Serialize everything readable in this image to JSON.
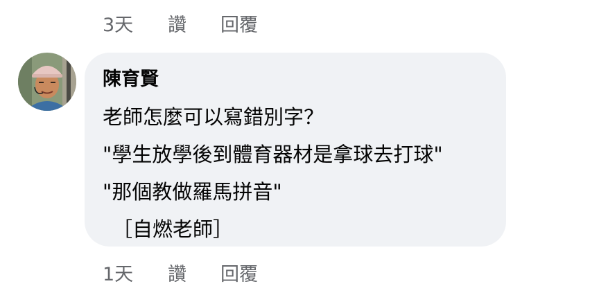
{
  "previous_comment": {
    "time": "3天",
    "like_label": "讚",
    "reply_label": "回覆"
  },
  "comment": {
    "author": "陳育賢",
    "lines": [
      "老師怎麼可以寫錯別字？",
      "\"學生放學後到體育器材是拿球去打球\"",
      "\"那個教做羅馬拼音\"",
      "［自燃老師］"
    ],
    "time": "1天",
    "like_label": "讚",
    "reply_label": "回覆"
  },
  "colors": {
    "bubble": "#f0f2f5",
    "secondary_text": "#65676b",
    "primary_text": "#050505"
  }
}
